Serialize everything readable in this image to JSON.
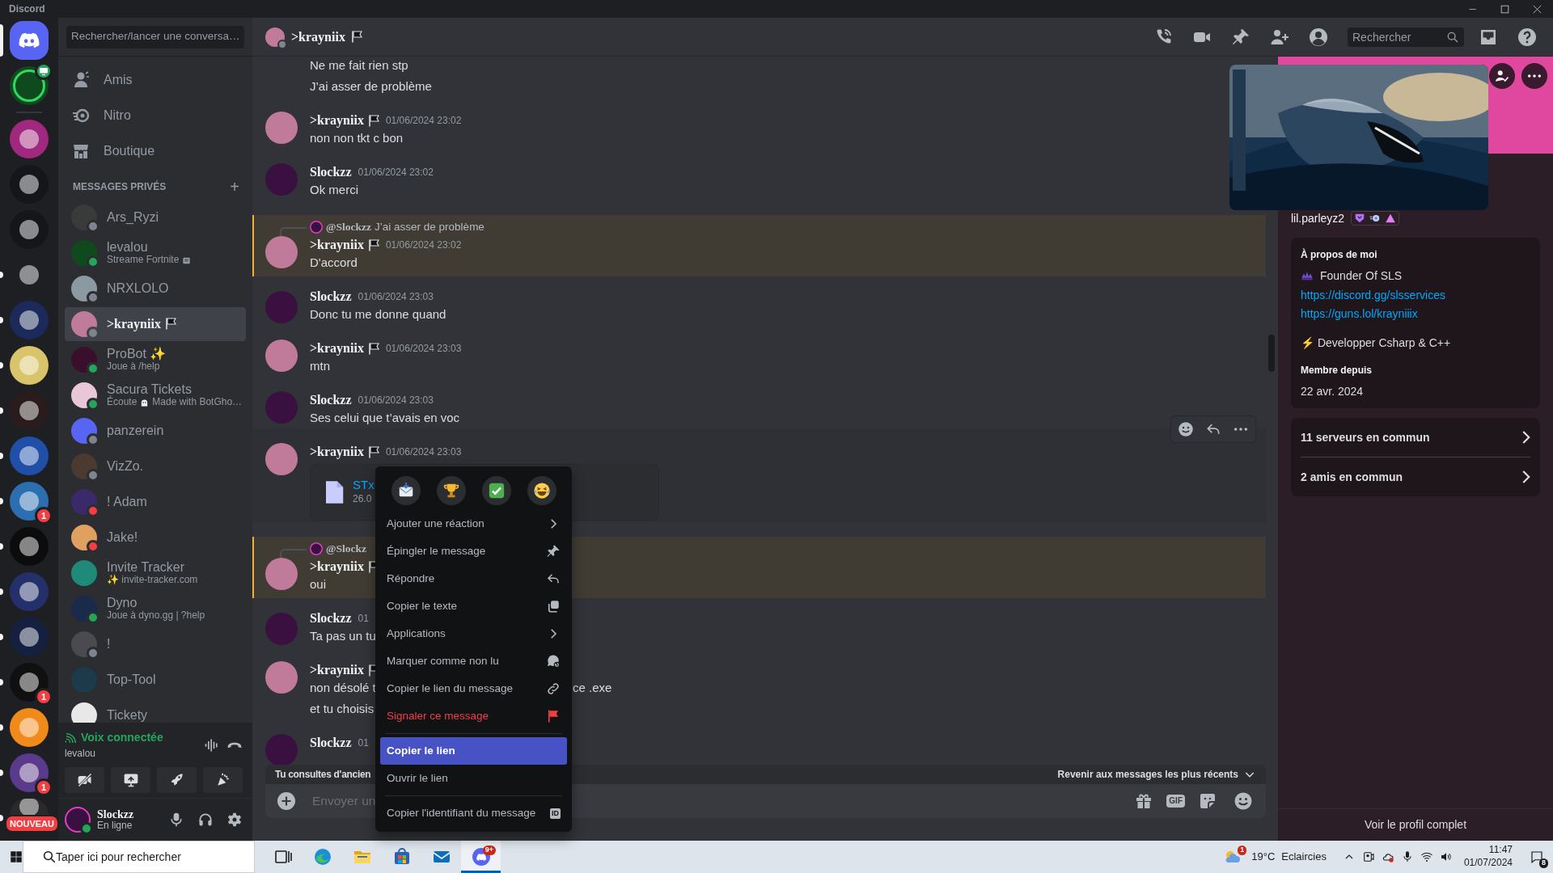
{
  "window": {
    "title": "Discord"
  },
  "servers": [
    {
      "kind": "home",
      "selected": true,
      "unread": false,
      "color": "#5865f2"
    },
    {
      "kind": "live",
      "selected": false,
      "unread": false,
      "color": "#0f4a1e"
    },
    {
      "kind": "separator"
    },
    {
      "kind": "server",
      "selected": false,
      "unread": false,
      "color": "#a0287e"
    },
    {
      "kind": "server",
      "selected": false,
      "unread": false,
      "color": "#15161a"
    },
    {
      "kind": "server",
      "selected": false,
      "unread": false,
      "color": "#15161a"
    },
    {
      "kind": "server",
      "selected": false,
      "unread": true,
      "color": "#1e1f22"
    },
    {
      "kind": "server",
      "selected": false,
      "unread": true,
      "color": "#1b2a5a"
    },
    {
      "kind": "server",
      "selected": false,
      "unread": true,
      "color": "#d8c46a"
    },
    {
      "kind": "server",
      "selected": false,
      "unread": true,
      "color": "#2a1c1c"
    },
    {
      "kind": "server",
      "selected": false,
      "unread": true,
      "color": "#1f4fa8"
    },
    {
      "kind": "server",
      "selected": false,
      "unread": true,
      "color": "#2c6fb0",
      "badge": "1"
    },
    {
      "kind": "server",
      "selected": false,
      "unread": true,
      "color": "#0c0c0c"
    },
    {
      "kind": "server",
      "selected": false,
      "unread": true,
      "color": "#24306a"
    },
    {
      "kind": "server",
      "selected": false,
      "unread": true,
      "color": "#152040"
    },
    {
      "kind": "server",
      "selected": false,
      "unread": true,
      "color": "#101010",
      "badge": "1"
    },
    {
      "kind": "server",
      "selected": false,
      "unread": true,
      "color": "#f08a1a"
    },
    {
      "kind": "server",
      "selected": false,
      "unread": true,
      "color": "#5a3a8a",
      "badge": "1"
    },
    {
      "kind": "server",
      "selected": false,
      "unread": true,
      "color": "#2a2a2a",
      "label": "NOUVEAU"
    }
  ],
  "sidebar": {
    "search": "Rechercher/lancer une conversa…",
    "nav": [
      {
        "label": "Amis"
      },
      {
        "label": "Nitro"
      },
      {
        "label": "Boutique"
      }
    ],
    "dm_header": "MESSAGES PRIVÉS",
    "add": "+",
    "dms": [
      {
        "name": "Ars_Ryzi",
        "color": "#80848e",
        "selected": false
      },
      {
        "name": "levalou",
        "activity": "Streame Fortnite",
        "rich_icon": true,
        "color": "#23a55a",
        "selected": false
      },
      {
        "name": "NRXLOLO",
        "color": "#80848e",
        "selected": false
      },
      {
        "name": ">krayniix",
        "flag": true,
        "color": "#80848e",
        "selected": true
      },
      {
        "name": "ProBot ✨",
        "activity": "Joue à /help",
        "color": "#23a55a",
        "selected": false
      },
      {
        "name": "Sacura Tickets",
        "activity": "Écoute",
        "activity_tail": "Made with BotGho…",
        "color": "#23a55a",
        "selected": false
      },
      {
        "name": "panzerein",
        "color": "#80848e",
        "selected": false
      },
      {
        "name": "VizZo.",
        "color": "#80848e",
        "selected": false
      },
      {
        "name": "! Adam",
        "color": "#f23f43",
        "selected": false
      },
      {
        "name": "Jake!",
        "color": "#f23f43",
        "selected": false
      },
      {
        "name": "Invite Tracker",
        "activity": "✨ invite-tracker.com",
        "selected": false
      },
      {
        "name": "Dyno",
        "activity": "Joue à dyno.gg | ?help",
        "color": "#23a55a",
        "selected": false
      },
      {
        "name": "!",
        "color": "#80848e",
        "selected": false
      },
      {
        "name": "Top-Tool",
        "selected": false
      },
      {
        "name": "Tickety",
        "selected": false
      }
    ],
    "voice": {
      "title": "Voix connectée",
      "channel": "levalou"
    },
    "user": {
      "name": "Slockzz",
      "status_text": "En ligne",
      "color": "#23a55a"
    }
  },
  "chat": {
    "title": ">krayniix",
    "flag": true,
    "search": {
      "placeholder": "Rechercher"
    },
    "messages": [
      {
        "kind": "lines",
        "lines": [
          {
            "text": "Ne me fait rien stp"
          },
          {
            "text": "J’ai asser de problème"
          }
        ]
      },
      {
        "kind": "message",
        "author": ">krayniix",
        "flag": true,
        "time": "01/06/2024 23:02",
        "color": "#c07a9a",
        "highlighted": false,
        "hovered": false,
        "lines": [
          {
            "text": "non non tkt c bon"
          }
        ]
      },
      {
        "kind": "message",
        "author": "Slockzz",
        "flag": false,
        "time": "01/06/2024 23:02",
        "color": "#3a1040",
        "highlighted": false,
        "hovered": false,
        "lines": [
          {
            "text": "Ok merci"
          }
        ]
      },
      {
        "kind": "message",
        "author": ">krayniix",
        "flag": true,
        "time": "01/06/2024 23:02",
        "color": "#c07a9a",
        "highlighted": true,
        "hovered": false,
        "reply": {
          "author": "@Slockzz",
          "text": "J’ai asser de problème"
        },
        "lines": [
          {
            "text": "D'accord"
          }
        ]
      },
      {
        "kind": "message",
        "author": "Slockzz",
        "flag": false,
        "time": "01/06/2024 23:03",
        "color": "#3a1040",
        "highlighted": false,
        "hovered": false,
        "lines": [
          {
            "text": "Donc tu me donne quand"
          }
        ]
      },
      {
        "kind": "message",
        "author": ">krayniix",
        "flag": true,
        "time": "01/06/2024 23:03",
        "color": "#c07a9a",
        "highlighted": false,
        "hovered": false,
        "lines": [
          {
            "text": "mtn"
          }
        ]
      },
      {
        "kind": "message",
        "author": "Slockzz",
        "flag": false,
        "time": "01/06/2024 23:03",
        "color": "#3a1040",
        "highlighted": false,
        "hovered": false,
        "lines": [
          {
            "text": "Ses celui que t’avais en voc"
          }
        ]
      },
      {
        "kind": "message",
        "author": ">krayniix",
        "flag": true,
        "time": "01/06/2024 23:03",
        "color": "#c07a9a",
        "highlighted": false,
        "hovered": true,
        "attachment": {
          "name": "STx",
          "size": "26.0"
        }
      },
      {
        "kind": "message",
        "author": ">krayniix",
        "flag": true,
        "color": "#c07a9a",
        "highlighted": true,
        "hovered": false,
        "reply": {
          "author": "@Slockz"
        },
        "lines": [
          {
            "text": "oui"
          }
        ]
      },
      {
        "kind": "message",
        "author": "Slockzz",
        "flag": false,
        "time": "01",
        "color": "#3a1040",
        "highlighted": false,
        "hovered": false,
        "lines": [
          {
            "text": "Ta pas un tu"
          }
        ]
      },
      {
        "kind": "message",
        "author": ">krayniix",
        "flag": true,
        "color": "#c07a9a",
        "highlighted": false,
        "hovered": false,
        "lines": [
          {
            "text": "non désolé t",
            "tail": "ce .exe"
          },
          {
            "text": "et tu choisis"
          }
        ]
      },
      {
        "kind": "message",
        "author": "Slockzz",
        "flag": false,
        "time": "01",
        "color": "#3a1040",
        "highlighted": false,
        "hovered": false
      }
    ],
    "jump": {
      "left": "Tu consultes d'ancien",
      "right": "Revenir aux messages les plus récents"
    },
    "composer": {
      "placeholder": "Envoyer un",
      "gif": "GIF"
    }
  },
  "context_menu": {
    "groups": [
      [
        {
          "label": "Ajouter une réaction",
          "danger": false,
          "selected": false
        },
        {
          "label": "Épingler le message",
          "danger": false,
          "selected": false
        },
        {
          "label": "Répondre",
          "danger": false,
          "selected": false
        },
        {
          "label": "Copier le texte",
          "danger": false,
          "selected": false
        },
        {
          "label": "Applications",
          "danger": false,
          "selected": false
        },
        {
          "label": "Marquer comme non lu",
          "danger": false,
          "selected": false
        },
        {
          "label": "Copier le lien du message",
          "danger": false,
          "selected": false
        },
        {
          "label": "Signaler ce message",
          "danger": true,
          "selected": false
        }
      ],
      [
        {
          "label": "Copier le lien",
          "danger": false,
          "selected": true
        },
        {
          "label": "Ouvrir le lien",
          "danger": false,
          "selected": false
        }
      ],
      [
        {
          "label": "Copier l'identifiant du message",
          "danger": false,
          "selected": false,
          "badge": "ID"
        }
      ]
    ]
  },
  "profile": {
    "username": "lil.parleyz2",
    "about_title": "À propos de moi",
    "about": [
      {
        "kind": "emoji_line",
        "text": "Founder Of SLS"
      },
      {
        "kind": "link",
        "text": "https://discord.gg/slsservices"
      },
      {
        "kind": "link",
        "text": "https://guns.lol/krayniiix"
      },
      {
        "kind": "text",
        "text": "⚡ Developper Csharp & C++"
      }
    ],
    "member_title": "Membre depuis",
    "member_since": "22 avr. 2024",
    "mutual": [
      {
        "label": "11 serveurs en commun"
      },
      {
        "label": "2 amis en commun"
      }
    ],
    "full_profile": "Voir le profil complet"
  },
  "taskbar": {
    "search": {
      "placeholder": "Taper ici pour rechercher"
    },
    "discord_badge": "9+",
    "weather_badge": "1",
    "temperature": "19°C",
    "weather": "Eclaircies",
    "time": "11:47",
    "date": "01/07/2024",
    "notifications": "8"
  }
}
